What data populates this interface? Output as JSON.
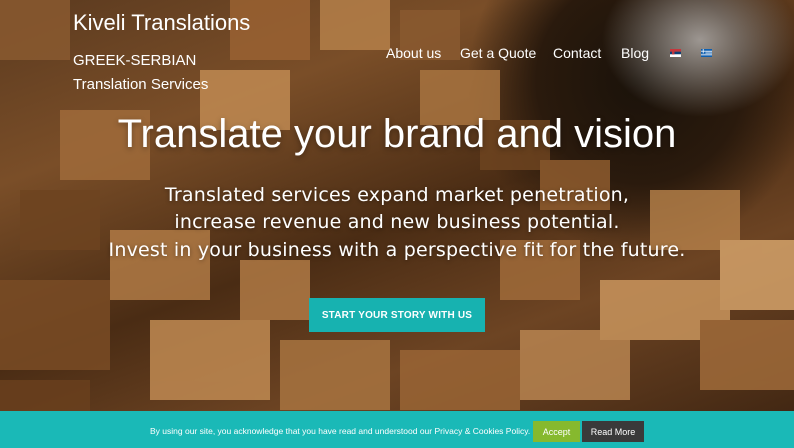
{
  "header": {
    "brand": "Kiveli Translations",
    "subtitle_line1": "GREEK-SERBIAN",
    "subtitle_line2": "Translation Services"
  },
  "nav": {
    "items": [
      {
        "label": "About us"
      },
      {
        "label": "Get a Quote"
      },
      {
        "label": "Contact"
      },
      {
        "label": "Blog"
      }
    ],
    "flags": [
      {
        "icon": "serbian-flag-icon"
      },
      {
        "icon": "greek-flag-icon"
      }
    ]
  },
  "hero": {
    "headline": "Translate your brand and vision",
    "tagline": [
      "Translated services expand market penetration,",
      "increase revenue and new business potential.",
      "Invest in your business with a perspective fit for the future."
    ],
    "cta_label": "START YOUR STORY WITH US"
  },
  "cookie_bar": {
    "text": "By using our site, you acknowledge that you have read and understood our Privacy & Cookies Policy.",
    "accept_label": "Accept",
    "read_more_label": "Read More"
  },
  "colors": {
    "accent": "#17b2b0",
    "cookie_bg": "#1ab9b7",
    "accept_bg": "#86b92e",
    "read_more_bg": "#3a3a3a"
  }
}
